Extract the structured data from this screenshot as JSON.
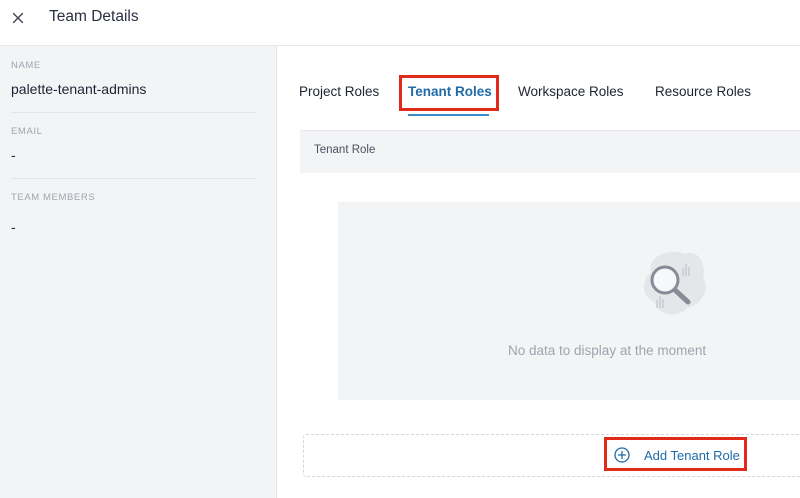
{
  "header": {
    "title": "Team Details",
    "close_icon": "close-icon"
  },
  "sidebar": {
    "name_label": "NAME",
    "name_value": "palette-tenant-admins",
    "email_label": "EMAIL",
    "email_value": "-",
    "members_label": "TEAM MEMBERS",
    "members_value": "-"
  },
  "tabs": [
    {
      "label": "Project Roles",
      "active": false
    },
    {
      "label": "Tenant Roles",
      "active": true
    },
    {
      "label": "Workspace Roles",
      "active": false
    },
    {
      "label": "Resource Roles",
      "active": false
    }
  ],
  "table": {
    "column_header": "Tenant Role"
  },
  "empty_state": {
    "message": "No data to display at the moment",
    "icon": "magnifier-icon"
  },
  "add_button": {
    "label": "Add Tenant Role",
    "icon": "plus-circle-icon"
  },
  "colors": {
    "accent": "#206ba8",
    "highlight": "#e02b1a",
    "sidebar_bg": "#f3f4f6"
  }
}
